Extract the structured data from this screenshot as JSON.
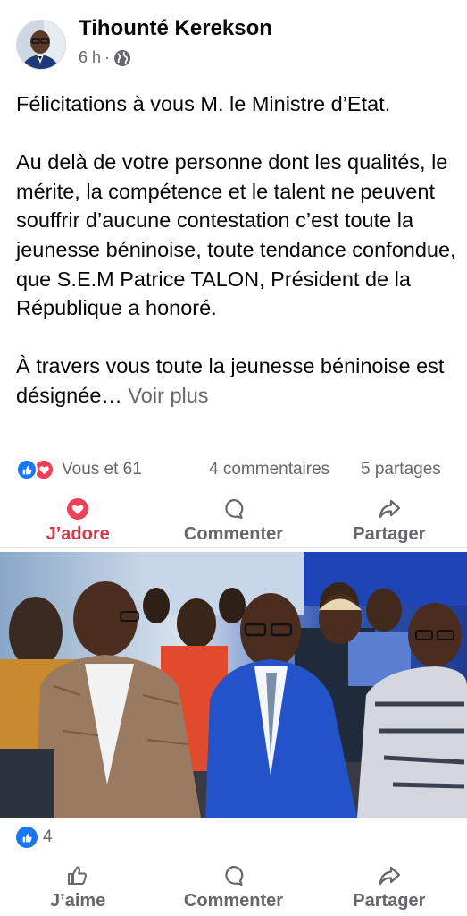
{
  "post": {
    "author": "Tihounté Kerekson",
    "time": "6 h",
    "separator": "·",
    "paragraphs": [
      "Félicitations à vous M. le Ministre d’Etat.",
      "Au delà de votre personne dont les qualités, le mérite, la compétence et le talent ne peuvent souffrir d’aucune contestation c’est toute la jeunesse béninoise, toute tendance confondue, que S.E.M Patrice TALON, Président de la République a honoré.",
      "À travers vous toute la jeunesse béninoise est désignée…"
    ],
    "see_more": "Voir plus"
  },
  "stats": {
    "reactions": "Vous et 61",
    "comments": "4 commentaires",
    "shares": "5 partages"
  },
  "actions_top": {
    "react": "J’adore",
    "comment": "Commenter",
    "share": "Partager"
  },
  "photo_stats": {
    "likes": "4"
  },
  "actions_bottom": {
    "like": "J’aime",
    "comment": "Commenter",
    "share": "Partager"
  },
  "colors": {
    "like_blue": "#1877f2",
    "love_red": "#f33e58",
    "active_action": "#d93848",
    "secondary_text": "#65676b"
  }
}
